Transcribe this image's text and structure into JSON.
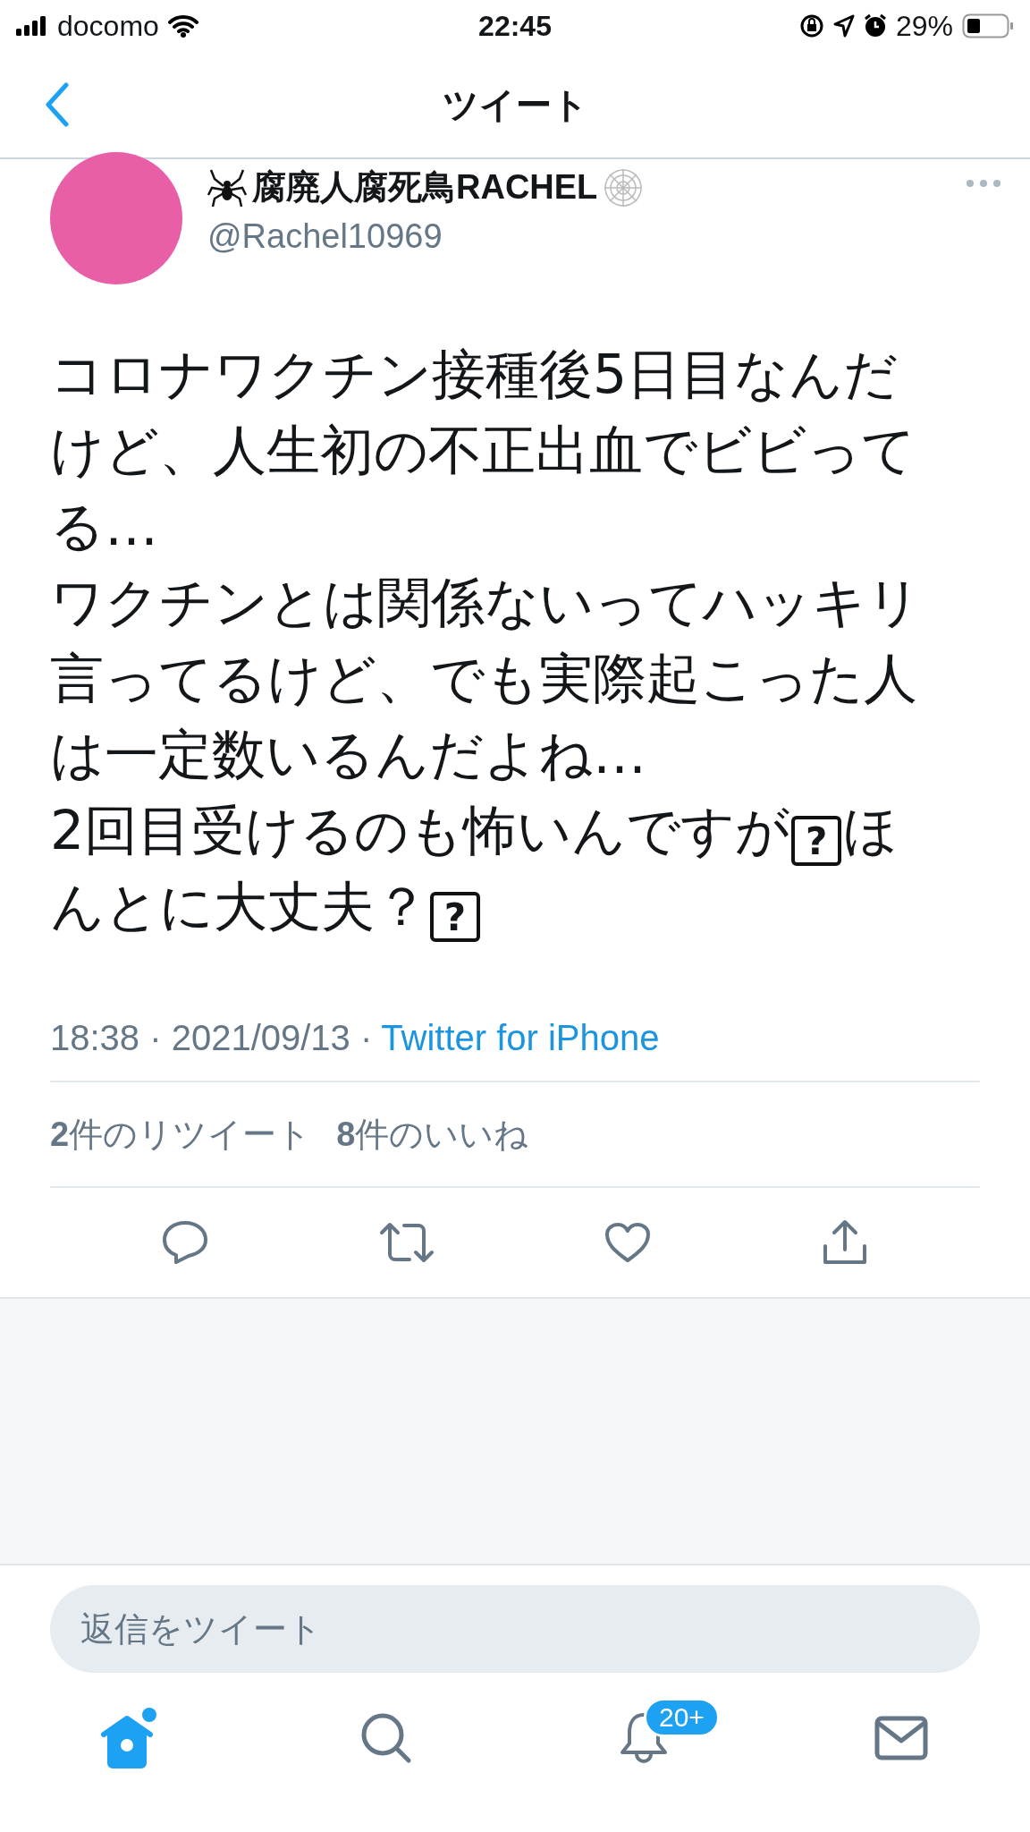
{
  "status_bar": {
    "carrier": "docomo",
    "time": "22:45",
    "battery": "29%"
  },
  "nav": {
    "title": "ツイート"
  },
  "tweet": {
    "author": {
      "name": "腐廃人腐死鳥RACHEL",
      "handle": "@Rachel10969"
    },
    "body": [
      {
        "kind": "text",
        "text": "コロナワクチン接種後5日目なんだけど、人生初の不正出血でビビってる…\nワクチンとは関係ないってハッキリ言ってるけど、でも実際起こった人は一定数いるんだよね…\n2回目受けるのも怖いんですが"
      },
      {
        "kind": "box",
        "text": "?"
      },
      {
        "kind": "text",
        "text": "ほんとに大丈夫？"
      },
      {
        "kind": "box",
        "text": "?"
      }
    ],
    "time": "18:38 · 2021/09/13 · ",
    "source": "Twitter for iPhone",
    "stats": [
      {
        "count": "2",
        "label": "件のリツイート"
      },
      {
        "count": "8",
        "label": "件のいいね"
      }
    ]
  },
  "reply": {
    "placeholder": "返信をツイート"
  },
  "tab_bar": [
    {
      "kind": "home",
      "selected": true
    },
    {
      "kind": "search",
      "selected": false
    },
    {
      "kind": "bell",
      "selected": false,
      "badge": "20+"
    },
    {
      "kind": "mail",
      "selected": false
    }
  ]
}
